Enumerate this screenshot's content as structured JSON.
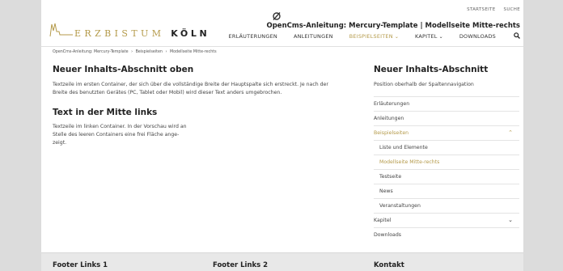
{
  "header": {
    "meta_nav": [
      "STARTSEITE",
      "SUCHE"
    ],
    "top_icon": "circle-slash-icon",
    "logo": {
      "text_a": "ERZBISTUM",
      "text_b": "KÖLN",
      "icon": "cathedral-skyline-icon"
    },
    "site_title": "OpenCms-Anleitung: Mercury-Template | Modellseite Mitte-rechts",
    "nav": [
      {
        "label": "ERLÄUTERUNGEN"
      },
      {
        "label": "ANLEITUNGEN"
      },
      {
        "label": "BEISPIELSEITEN",
        "chevron": "⌄"
      },
      {
        "label": "KAPITEL",
        "chevron": "⌄"
      },
      {
        "label": "DOWNLOADS"
      }
    ],
    "search_icon": "search-icon"
  },
  "breadcrumb": [
    "OpenCms-Anleitung: Mercury-Template",
    "Beispielseiten",
    "Modellseite Mitte-rechts"
  ],
  "breadcrumb_sep": "›",
  "main": {
    "heading_top": "Neuer Inhalts-Abschnitt oben",
    "text_top_line1": "Textzeile im ersten Container, der sich über die vollständige Breite der Hauptspalte sich erstreckt. Je nach der",
    "text_top_line2": "Breite des benutzten Gerätes (PC, Tablet oder Mobil) wird dieser Text anders umgebrochen.",
    "heading_left": "Text in der Mitte links",
    "text_left_line1": "Textzeile im linken Container. In der Vorschau wird an",
    "text_left_line2": "Stelle des leeren Containers eine frei Fläche ange-",
    "text_left_line3": "zeigt."
  },
  "sidebar": {
    "heading": "Neuer Inhalts-Abschnitt",
    "text": "Position oberhalb der Spaltennavigation",
    "items": [
      {
        "label": "Erläuterungen"
      },
      {
        "label": "Anleitungen"
      },
      {
        "label": "Beispielseiten",
        "chevron": "⌃"
      },
      {
        "label": "Liste und Elemente"
      },
      {
        "label": "Modellseite Mitte-rechts"
      },
      {
        "label": "Testseite"
      },
      {
        "label": "News"
      },
      {
        "label": "Veranstaltungen"
      },
      {
        "label": "Kapitel",
        "chevron": "⌄"
      },
      {
        "label": "Downloads"
      }
    ]
  },
  "footer": {
    "col1": "Footer Links 1",
    "col2": "Footer Links 2",
    "col3": "Kontakt"
  },
  "colors": {
    "accent": "#b49a4a",
    "text": "#333333",
    "background": "#dcdcdc",
    "footer": "#e8e8e8"
  }
}
